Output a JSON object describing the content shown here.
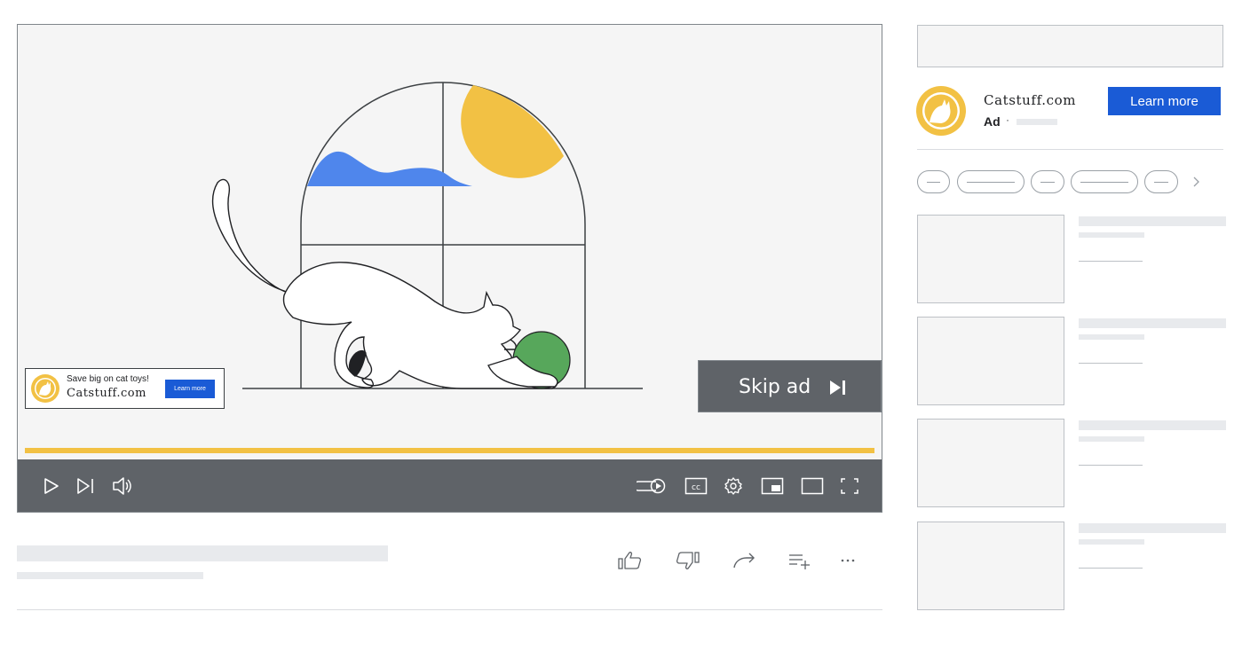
{
  "player": {
    "overlay_ad": {
      "text": "Save big on cat toys!",
      "brand": "Catstuff.com",
      "button_label": "Learn more"
    },
    "skip_label": "Skip ad",
    "progress_fraction": 1.0,
    "controls_left": [
      "play-icon",
      "next-icon",
      "volume-icon"
    ],
    "controls_right": [
      "autoplay-toggle-icon",
      "captions-icon",
      "settings-icon",
      "miniplayer-icon",
      "theater-icon",
      "fullscreen-icon"
    ],
    "captions_text": "cc"
  },
  "actions": [
    "like-icon",
    "dislike-icon",
    "share-icon",
    "save-to-playlist-icon",
    "more-icon"
  ],
  "sidebar": {
    "ad": {
      "brand": "Catstuff.com",
      "label": "Ad",
      "separator": "·",
      "button_label": "Learn more"
    },
    "chip_count": 5,
    "card_count": 4
  },
  "colors": {
    "accent_blue": "#1a5bd6",
    "progress_yellow": "#f2c144",
    "controls_gray": "#5f6368",
    "ball_green": "#57a75b",
    "sun_yellow": "#f2c144",
    "cloud_blue": "#4f86ec"
  }
}
